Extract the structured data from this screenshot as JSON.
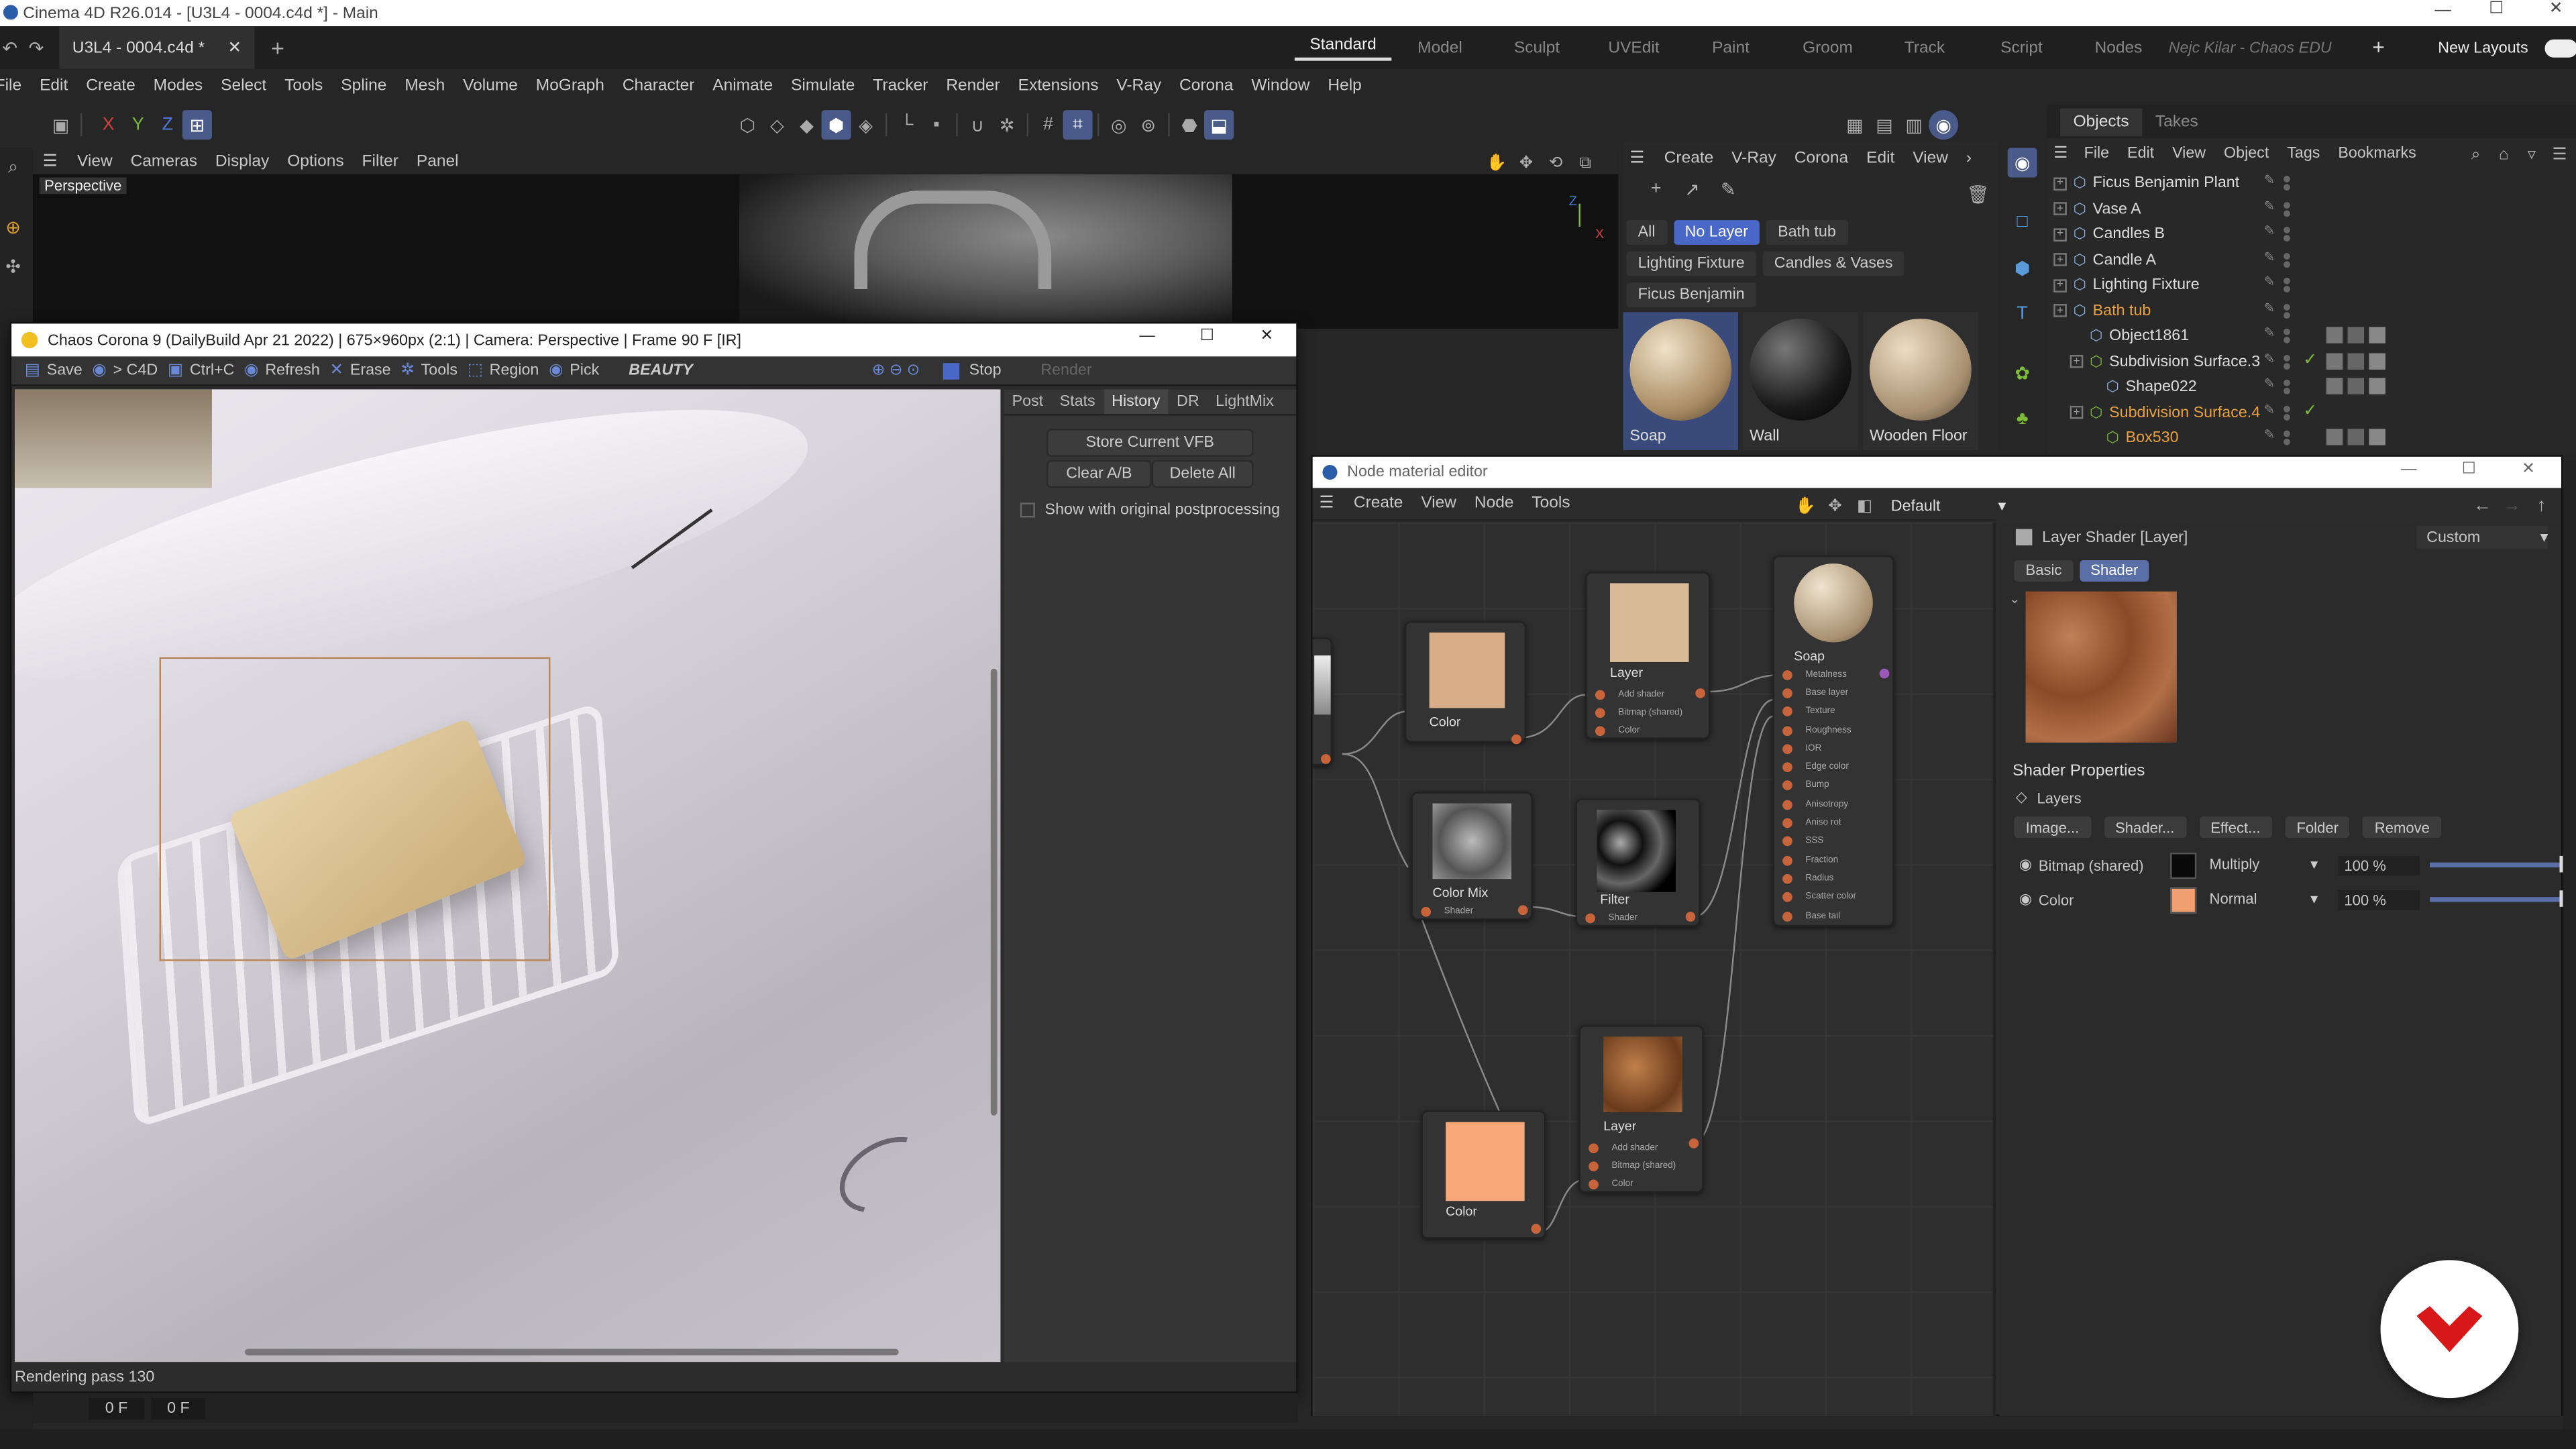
{
  "app": {
    "title": "Cinema 4D R26.014 - [U3L4 - 0004.c4d *] - Main",
    "tab": "U3L4 - 0004.c4d *"
  },
  "layouts": [
    "Standard",
    "Model",
    "Sculpt",
    "UVEdit",
    "Paint",
    "Groom",
    "Track",
    "Script",
    "Nodes"
  ],
  "user": "Nejc Kilar - Chaos EDU",
  "new_layouts": "New Layouts",
  "menu": [
    "File",
    "Edit",
    "Create",
    "Modes",
    "Select",
    "Tools",
    "Spline",
    "Mesh",
    "Volume",
    "MoGraph",
    "Character",
    "Animate",
    "Simulate",
    "Tracker",
    "Render",
    "Extensions",
    "V-Ray",
    "Corona",
    "Window",
    "Help"
  ],
  "axes": [
    "X",
    "Y",
    "Z"
  ],
  "viewport": {
    "menu": [
      "View",
      "Cameras",
      "Display",
      "Options",
      "Filter",
      "Panel"
    ],
    "label": "Perspective"
  },
  "vfb": {
    "title": "Chaos Corona 9 (DailyBuild Apr 21 2022) | 675×960px (2:1) | Camera: Perspective | Frame 90 F [IR]",
    "toolbar": [
      "Save",
      "> C4D",
      "Ctrl+C",
      "Refresh",
      "Erase",
      "Tools",
      "Region",
      "Pick"
    ],
    "channel": "BEAUTY",
    "stop": "Stop",
    "render": "Render",
    "tabs": [
      "Post",
      "Stats",
      "History",
      "DR",
      "LightMix"
    ],
    "store": "Store Current VFB",
    "clear": "Clear A/B",
    "delete": "Delete All",
    "show_original": "Show with original postprocessing",
    "status": "Rendering pass 130"
  },
  "timeline": {
    "a": "0 F",
    "b": "0 F"
  },
  "matmgr": {
    "menu": [
      "Create",
      "V-Ray",
      "Corona",
      "Edit",
      "View"
    ],
    "filters": [
      "All",
      "No Layer",
      "Bath tub",
      "Lighting Fixture",
      "Candles & Vases",
      "Ficus Benjamin"
    ],
    "materials": [
      "Soap",
      "Wall",
      "Wooden Floor"
    ]
  },
  "objects": {
    "tabs": [
      "Objects",
      "Takes"
    ],
    "menu": [
      "File",
      "Edit",
      "View",
      "Object",
      "Tags",
      "Bookmarks"
    ],
    "items": [
      "Ficus Benjamin Plant",
      "Vase A",
      "Candles B",
      "Candle A",
      "Lighting Fixture",
      "Bath tub",
      "Object1861",
      "Subdivision Surface.3",
      "Shape022",
      "Subdivision Surface.4",
      "Box530"
    ]
  },
  "node_editor": {
    "title": "Node material editor",
    "menu": [
      "Create",
      "View",
      "Node",
      "Tools"
    ],
    "preset": "Default",
    "nodes": {
      "color1": "Color",
      "layer1": "Layer",
      "soap": "Soap",
      "colormix": "Color Mix",
      "filter": "Filter",
      "layer2": "Layer",
      "color2": "Color"
    },
    "ports": {
      "add_shader": "Add shader",
      "bitmap": "Bitmap (shared)",
      "color": "Color",
      "shader": "Shader"
    },
    "soap_ports": [
      "Metalness",
      "Base layer",
      "Texture",
      "Roughness",
      "IOR",
      "Edge color",
      "Bump",
      "Anisotropy",
      "Aniso rot",
      "SSS",
      "Fraction",
      "Radius",
      "Scatter color",
      "Base tail"
    ]
  },
  "attributes": {
    "title": "Layer Shader [Layer]",
    "mode": "Custom",
    "tabs": [
      "Basic",
      "Shader"
    ],
    "section": "Shader Properties",
    "layers_label": "Layers",
    "buttons": [
      "Image...",
      "Shader...",
      "Effect...",
      "Folder",
      "Remove"
    ],
    "layers": [
      {
        "name": "Bitmap (shared)",
        "blend": "Multiply",
        "pct": "100 %",
        "swatch": "#0a0a0a"
      },
      {
        "name": "Color",
        "blend": "Normal",
        "pct": "100 %",
        "swatch": "#f0a070"
      }
    ]
  }
}
